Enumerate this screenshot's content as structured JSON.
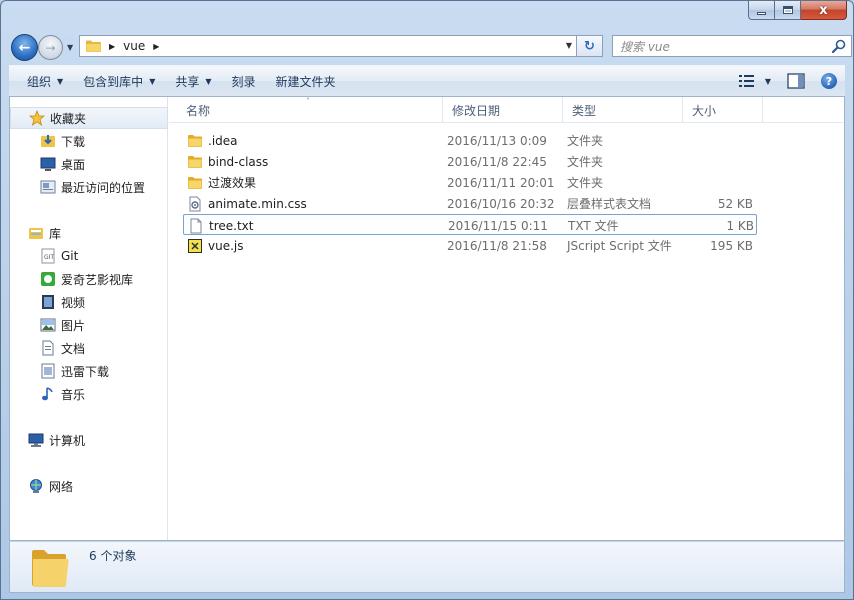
{
  "window": {
    "caption_close": "x"
  },
  "navbar": {
    "breadcrumb": [
      "vue"
    ],
    "search_placeholder": "搜索 vue"
  },
  "toolbar": {
    "organize": "组织",
    "include_in_library": "包含到库中",
    "share": "共享",
    "burn": "刻录",
    "new_folder": "新建文件夹"
  },
  "sidebar": {
    "favorites": {
      "label": "收藏夹",
      "items": [
        "下载",
        "桌面",
        "最近访问的位置"
      ]
    },
    "libraries": {
      "label": "库",
      "items": [
        "Git",
        "爱奇艺影视库",
        "视频",
        "图片",
        "文档",
        "迅雷下载",
        "音乐"
      ]
    },
    "computer": "计算机",
    "network": "网络"
  },
  "columns": {
    "name": "名称",
    "date": "修改日期",
    "type": "类型",
    "size": "大小"
  },
  "files": [
    {
      "name": ".idea",
      "date": "2016/11/13 0:09",
      "type": "文件夹",
      "size": "",
      "icon": "folder-icon"
    },
    {
      "name": "bind-class",
      "date": "2016/11/8 22:45",
      "type": "文件夹",
      "size": "",
      "icon": "folder-icon"
    },
    {
      "name": "过渡效果",
      "date": "2016/11/11 20:01",
      "type": "文件夹",
      "size": "",
      "icon": "folder-icon"
    },
    {
      "name": "animate.min.css",
      "date": "2016/10/16 20:32",
      "type": "层叠样式表文档",
      "size": "52 KB",
      "icon": "css-file-icon"
    },
    {
      "name": "tree.txt",
      "date": "2016/11/15 0:11",
      "type": "TXT 文件",
      "size": "1 KB",
      "icon": "text-file-icon"
    },
    {
      "name": "vue.js",
      "date": "2016/11/8 21:58",
      "type": "JScript Script 文件",
      "size": "195 KB",
      "icon": "script-file-icon"
    }
  ],
  "selected_file": "tree.txt",
  "status": {
    "count_text": "6 个对象"
  },
  "colors": {
    "accent": "#2d6fc4",
    "folder": "#f0c445",
    "selection_border": "#7da2ce"
  }
}
